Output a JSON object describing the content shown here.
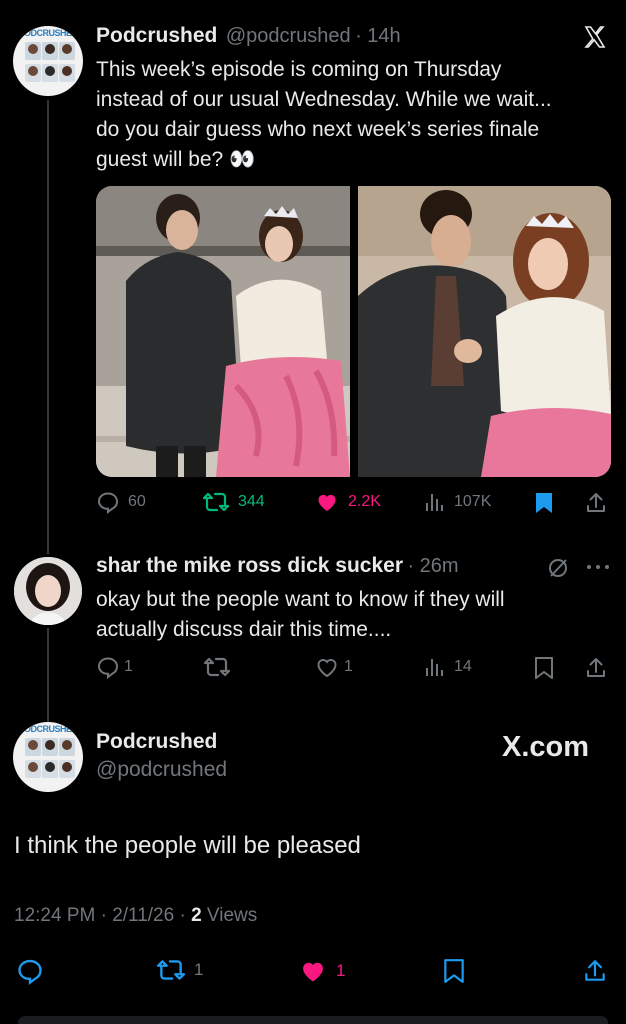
{
  "tweet1": {
    "name": "Podcrushed",
    "handle": "@podcrushed",
    "time": "· 14h",
    "line1": "This week’s episode is coming on Thursday",
    "line2": "instead of our usual Wednesday. While we wait...",
    "line3": "do you dair guess who next week’s series finale",
    "line4": "guest will be? 👀",
    "replies": "60",
    "reposts": "344",
    "likes": "2.2K",
    "views": "107K"
  },
  "tweet2": {
    "name": "shar the mike ross dick sucker",
    "time": "· 26m",
    "line1": "okay but the people want to know if they will",
    "line2": "actually discuss dair this time....",
    "replies": "1",
    "likes": "1",
    "views": "14"
  },
  "tweet3": {
    "name": "Podcrushed",
    "handle": "@podcrushed",
    "brand": "X.com",
    "text": "I think the people will be pleased",
    "time": "12:24 PM · 2/11/26 · ",
    "views_count": "2",
    "views_label": " Views",
    "reposts": "1",
    "likes": "1"
  },
  "avatar_band_text": "PODCRUSHED",
  "colors": {
    "background": "#000000",
    "text": "#e7e9ea",
    "muted": "#71767b",
    "repost_green": "#00ba7c",
    "like_pink": "#f91880",
    "bookmark_blue": "#1d9bf0"
  },
  "icons": [
    "x-logo-icon",
    "reply-icon",
    "repost-icon",
    "like-icon",
    "views-icon",
    "bookmark-icon",
    "share-icon",
    "more-icon",
    "grok-icon"
  ]
}
